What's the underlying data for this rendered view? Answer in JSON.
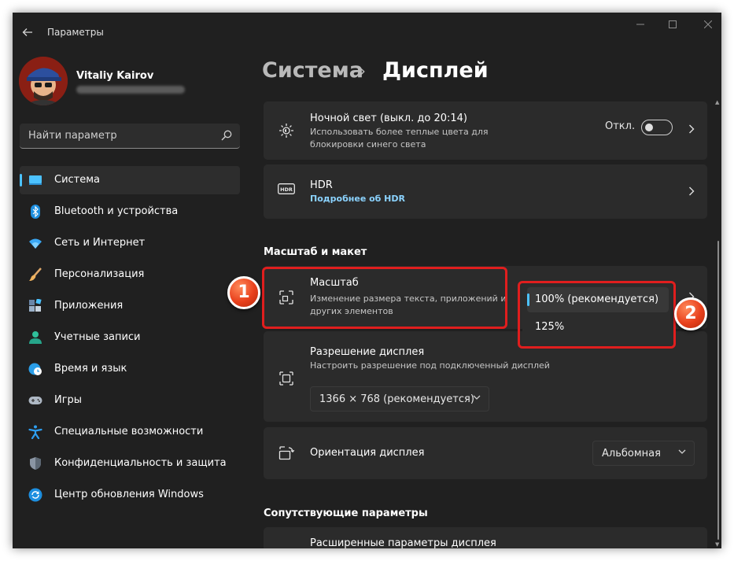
{
  "window": {
    "title": "Параметры",
    "back_icon": "arrow-left-icon"
  },
  "profile": {
    "name": "Vitaliy Kairov"
  },
  "search": {
    "placeholder": "Найти параметр"
  },
  "sidebar": {
    "items": [
      {
        "label": "Система",
        "icon": "monitor-icon",
        "active": true
      },
      {
        "label": "Bluetooth и устройства",
        "icon": "bluetooth-icon"
      },
      {
        "label": "Сеть и Интернет",
        "icon": "wifi-icon"
      },
      {
        "label": "Персонализация",
        "icon": "brush-icon"
      },
      {
        "label": "Приложения",
        "icon": "apps-icon"
      },
      {
        "label": "Учетные записи",
        "icon": "person-icon"
      },
      {
        "label": "Время и язык",
        "icon": "globe-clock-icon"
      },
      {
        "label": "Игры",
        "icon": "gamepad-icon"
      },
      {
        "label": "Специальные возможности",
        "icon": "accessibility-icon"
      },
      {
        "label": "Конфиденциальность и защита",
        "icon": "shield-icon"
      },
      {
        "label": "Центр обновления Windows",
        "icon": "update-icon"
      }
    ]
  },
  "breadcrumb": {
    "parent": "Система",
    "separator": "›",
    "current": "Дисплей"
  },
  "night_light": {
    "title": "Ночной свет (выкл. до 20:14)",
    "description": "Использовать более теплые цвета для блокировки синего света",
    "state": "Откл."
  },
  "hdr": {
    "title": "HDR",
    "link": "Подробнее об HDR"
  },
  "layout_section": {
    "title": "Масштаб и макет"
  },
  "scale": {
    "title": "Масштаб",
    "description": "Изменение размера текста, приложений и других элементов",
    "options": [
      "100% (рекомендуется)",
      "125%"
    ],
    "selected": "100% (рекомендуется)"
  },
  "resolution": {
    "title": "Разрешение дисплея",
    "description": "Настроить разрешение под подключенный дисплей",
    "value": "1366 × 768 (рекомендуется)"
  },
  "orientation": {
    "title": "Ориентация дисплея",
    "value": "Альбомная"
  },
  "related_section": {
    "title": "Сопутствующие параметры"
  },
  "advanced_display": {
    "title": "Расширенные параметры дисплея"
  },
  "annotations": {
    "badge_1": "1",
    "badge_2": "2",
    "color": "#e01e1e"
  },
  "colors": {
    "accent": "#4cc2ff",
    "background": "#202020",
    "card": "#2b2b2b",
    "link": "#8bd3ff"
  }
}
